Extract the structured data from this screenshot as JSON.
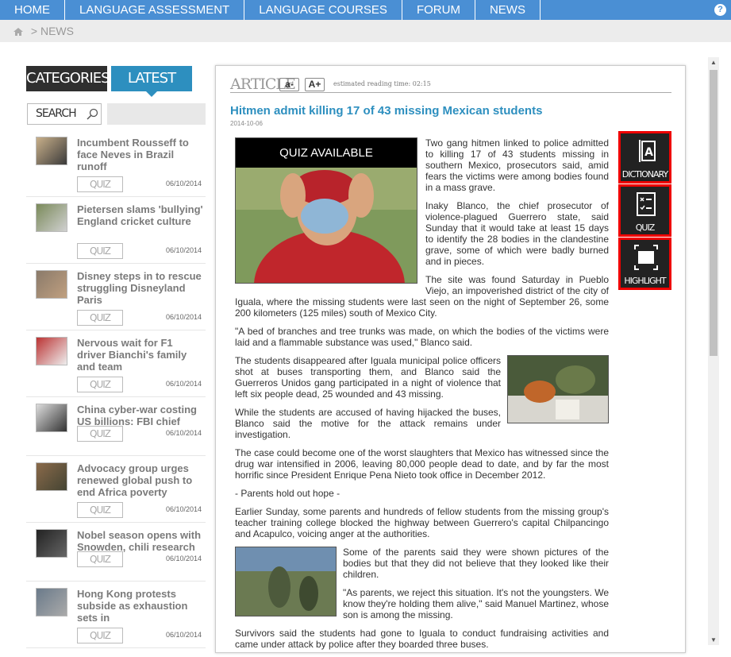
{
  "nav": {
    "items": [
      "HOME",
      "LANGUAGE ASSESSMENT",
      "LANGUAGE COURSES",
      "FORUM",
      "NEWS"
    ],
    "help": "?"
  },
  "breadcrumb": {
    "sep": ">",
    "current": "NEWS"
  },
  "tabs": {
    "categories": "CATEGORIES",
    "latest": "LATEST"
  },
  "search": {
    "label": "SEARCH"
  },
  "sidebar": {
    "quiz_label": "QUIZ",
    "items": [
      {
        "title": "Incumbent Rousseff to face Neves in Brazil runoff",
        "date": "06/10/2014"
      },
      {
        "title": "Pietersen slams 'bullying' England cricket culture",
        "date": "06/10/2014"
      },
      {
        "title": "Disney steps in to rescue struggling Disneyland Paris",
        "date": "06/10/2014"
      },
      {
        "title": "Nervous wait for F1 driver Bianchi's family and team",
        "date": "06/10/2014"
      },
      {
        "title": "China cyber-war costing US billions: FBI chief",
        "date": "06/10/2014"
      },
      {
        "title": "Advocacy group urges renewed global push to end Africa poverty",
        "date": "06/10/2014"
      },
      {
        "title": "Nobel season opens with Snowden, chili research",
        "date": "06/10/2014"
      },
      {
        "title": "Hong Kong protests subside as exhaustion sets in",
        "date": "06/10/2014"
      }
    ]
  },
  "article": {
    "label": "ARTICLE",
    "font_minus": "a-",
    "font_plus": "A+",
    "read_time": "estimated reading time: 02:15",
    "headline": "Hitmen admit killing 17 of 43 missing Mexican students",
    "date": "2014-10-06",
    "quiz_banner": "QUIZ AVAILABLE",
    "p1": "Two gang hitmen linked to police admitted to killing 17 of 43 students missing in southern Mexico, prosecutors said, amid fears the victims were among bodies found in a mass grave.",
    "p2": "Inaky Blanco, the chief prosecutor of violence-plagued Guerrero state, said Sunday that it would take at least 15 days to identify the 28 bodies in the clandestine grave, some of which were badly burned and in pieces.",
    "p3": "The site was found Saturday in Pueblo Viejo, an impoverished district of the city of Iguala, where the missing students were last seen on the night of September 26, some 200 kilometers (125 miles) south of Mexico City.",
    "p4": "\"A bed of branches and tree trunks was made, on which the bodies of the victims were laid and a flammable substance was used,\" Blanco said.",
    "p5": "The students disappeared after Iguala municipal police officers shot at buses transporting them, and Blanco said the Guerreros Unidos gang participated in a night of violence that left six people dead, 25 wounded and 43 missing.",
    "p6": "While the students are accused of having hijacked the buses, Blanco said the motive for the attack remains under investigation.",
    "p7": "The case could become one of the worst slaughters that Mexico has witnessed since the drug war intensified in 2006, leaving 80,000 people dead to date, and by far the most horrific since President Enrique Pena Nieto took office in December 2012.",
    "p8": "- Parents hold out hope -",
    "p9": "Earlier Sunday, some parents and hundreds of fellow students from the missing group's teacher training college blocked the highway between Guerrero's capital Chilpancingo and Acapulco, voicing anger at the authorities.",
    "p10": "Some of the parents said they were shown pictures of the bodies but that they did not believe that they looked like their children.",
    "p11": "\"As parents, we reject this situation. It's not the youngsters. We know they're holding them alive,\" said Manuel Martinez, whose son is among the missing.",
    "p12": "Survivors said the students had gone to Iguala to conduct fundraising activities and came under attack by police after they boarded three buses."
  },
  "tools": {
    "dictionary": "DICTIONARY",
    "quiz": "QUIZ",
    "highlight": "HIGHLIGHT"
  }
}
